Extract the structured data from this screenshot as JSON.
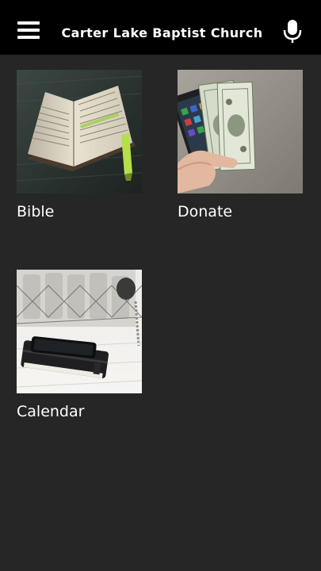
{
  "header": {
    "title": "Carter Lake Baptist Church",
    "menu_icon": "hamburger-menu-icon",
    "mic_icon": "microphone-icon",
    "background_color": "#000000"
  },
  "page": {
    "background_color": "#262626"
  },
  "tiles": [
    {
      "label": "Bible",
      "image": "open-bible-photo"
    },
    {
      "label": "Donate",
      "image": "hand-holding-cash-and-phone-photo"
    },
    {
      "label": "Calendar",
      "image": "planner-and-phone-on-table-photo"
    }
  ]
}
